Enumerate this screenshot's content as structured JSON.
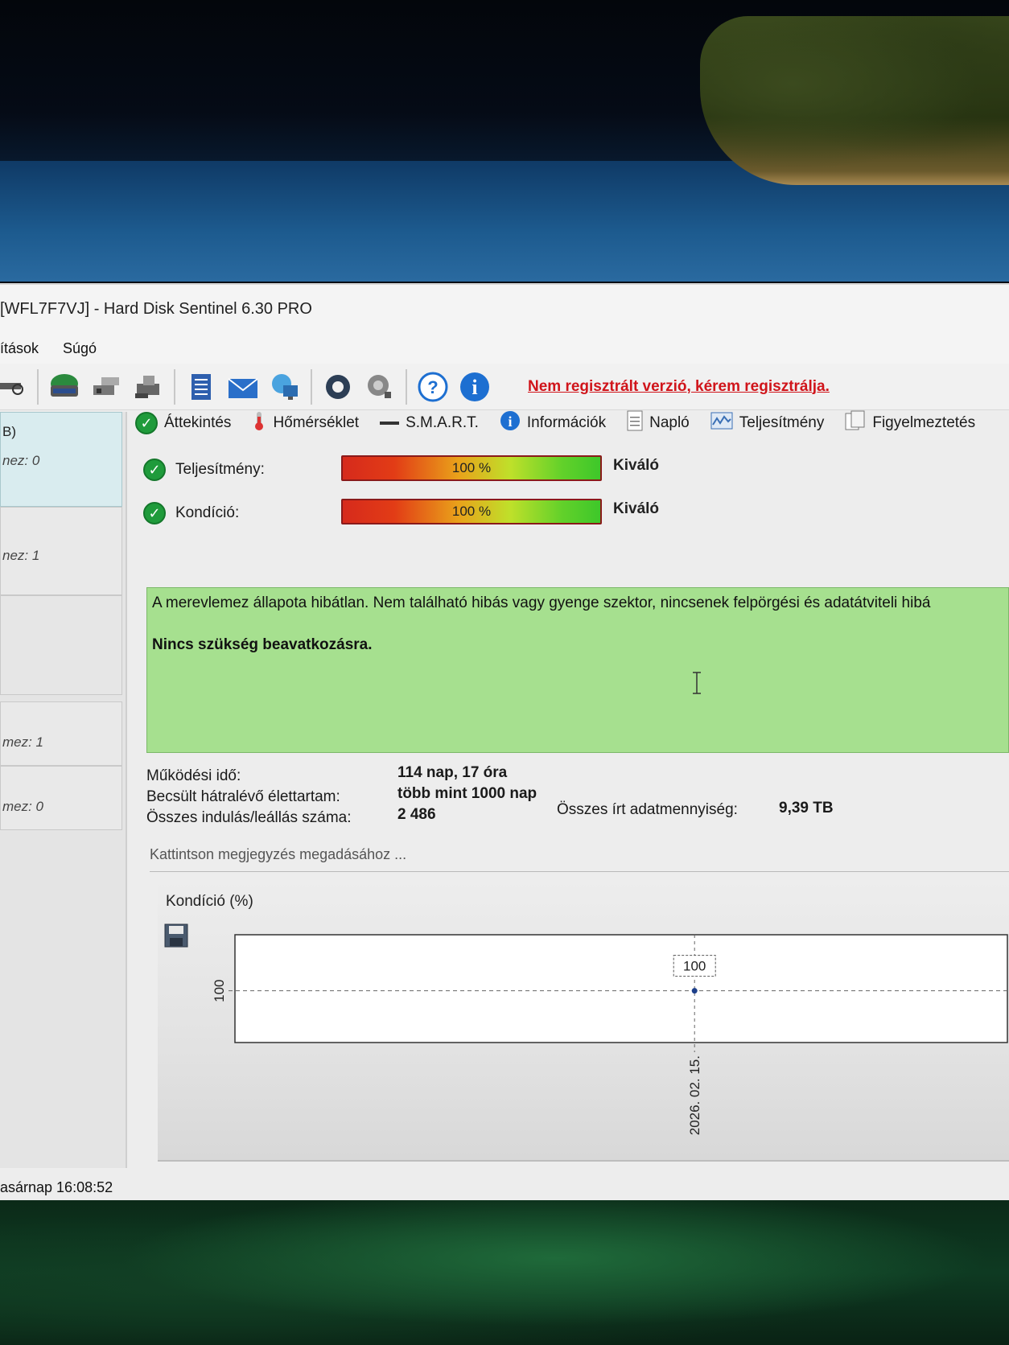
{
  "window": {
    "title": "[WFL7F7VJ]  -  Hard Disk Sentinel 6.30 PRO"
  },
  "menu": [
    "ítások",
    "Súgó"
  ],
  "toolbar": {
    "register_link": "Nem regisztrált verzió, kérem regisztrálja.",
    "icons": [
      "search-icon",
      "disk-icon",
      "tools-icon",
      "printer-icon",
      "report-icon",
      "mail-icon",
      "network-icon",
      "settings-icon",
      "sound-icon",
      "help-icon",
      "info-icon"
    ]
  },
  "left_panel": {
    "items": [
      {
        "title": "B)",
        "sub": "nez: 0"
      },
      {
        "sub": "nez: 1"
      },
      {
        "sub": "mez: 1"
      },
      {
        "sub": "mez: 0"
      }
    ]
  },
  "tabs": [
    {
      "label": "Áttekintés",
      "icon": "check-icon"
    },
    {
      "label": "Hőmérséklet",
      "icon": "thermometer-icon"
    },
    {
      "label": "S.M.A.R.T.",
      "icon": "smart-icon"
    },
    {
      "label": "Információk",
      "icon": "info-icon"
    },
    {
      "label": "Napló",
      "icon": "log-icon"
    },
    {
      "label": "Teljesítmény",
      "icon": "performance-icon"
    },
    {
      "label": "Figyelmeztetés",
      "icon": "alert-icon"
    }
  ],
  "metrics": {
    "performance": {
      "label": "Teljesítmény:",
      "value": "100 %",
      "fraction": 1.0,
      "rating": "Kiváló"
    },
    "condition": {
      "label": "Kondíció:",
      "value": "100 %",
      "fraction": 1.0,
      "rating": "Kiváló"
    }
  },
  "status": {
    "message": "A merevlemez állapota hibátlan. Nem található hibás vagy gyenge szektor, nincsenek felpörgési és adatátviteli hibá",
    "action": "Nincs szükség beavatkozásra."
  },
  "info": {
    "uptime_label": "Működési idő:",
    "uptime_value": "114 nap, 17 óra",
    "lifetime_label": "Becsült hátralévő élettartam:",
    "lifetime_value": "több mint 1000 nap",
    "startstop_label": "Összes indulás/leállás száma:",
    "startstop_value": "2 486",
    "written_label": "Összes írt adatmennyiség:",
    "written_value": "9,39 TB"
  },
  "note": {
    "placeholder": "Kattintson megjegyzés megadásához ..."
  },
  "chart_title": "Kondíció  (%)",
  "chart_data": {
    "type": "line",
    "title": "Kondíció  (%)",
    "x": [
      "2026. 02. 15."
    ],
    "series": [
      {
        "values": [
          100
        ]
      }
    ],
    "y_tick_labels": [
      "100"
    ],
    "data_labels": [
      "100"
    ],
    "grid": false
  },
  "statusbar": {
    "text": "asárnap 16:08:52"
  }
}
